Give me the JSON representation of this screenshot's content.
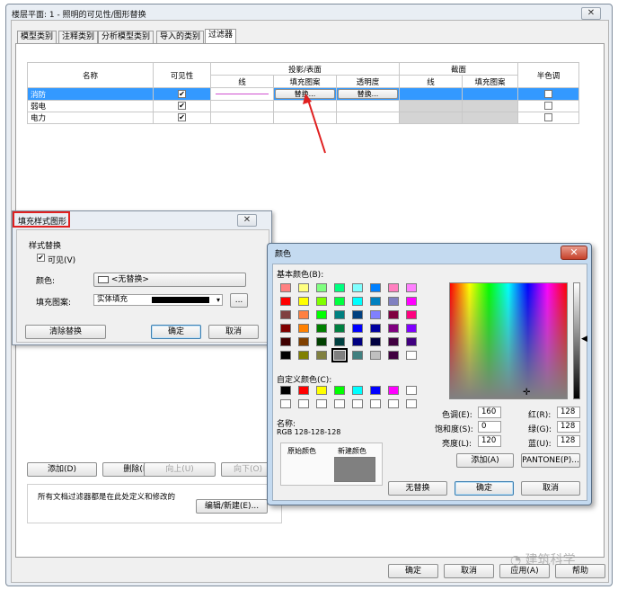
{
  "main_window": {
    "title": "楼层平面: 1 - 照明的可见性/图形替换",
    "close_icon": "close-icon",
    "tabs": [
      "模型类别",
      "注释类别",
      "分析模型类别",
      "导入的类别",
      "过滤器"
    ],
    "active_tab_index": 4,
    "table": {
      "headers": {
        "name": "名称",
        "visibility": "可见性",
        "projection_surface": "投影/表面",
        "cut": "截面",
        "halftone": "半色调",
        "line": "线",
        "fill_pattern": "填充图案",
        "transparency": "透明度",
        "cut_line": "线",
        "cut_fill_pattern": "填充图案"
      },
      "rows": [
        {
          "name": "消防",
          "visible": true,
          "proj_fill": "替换...",
          "transparency": "替换...",
          "halftone": false,
          "selected": true
        },
        {
          "name": "弱电",
          "visible": true,
          "proj_fill": "",
          "transparency": "",
          "halftone": false,
          "selected": false
        },
        {
          "name": "电力",
          "visible": true,
          "proj_fill": "",
          "transparency": "",
          "halftone": false,
          "selected": false
        }
      ]
    },
    "buttons": {
      "add": "添加(D)",
      "delete": "删除(R)",
      "up": "向上(U)",
      "down": "向下(O)",
      "edit_new": "编辑/新建(E)...",
      "ok": "确定",
      "cancel": "取消",
      "apply": "应用(A)",
      "help": "帮助"
    },
    "filters_note": "所有文档过滤器都是在此处定义和修改的"
  },
  "fill_dialog": {
    "title": "填充样式图形",
    "group_label": "样式替换",
    "visible_label": "可见(V)",
    "visible_checked": true,
    "color_label": "颜色:",
    "color_value": "<无替换>",
    "pattern_label": "填充图案:",
    "pattern_value": "实体填充",
    "browse": "...",
    "clear": "清除替换",
    "ok": "确定",
    "cancel": "取消"
  },
  "color_dialog": {
    "title": "颜色",
    "basic_colors_label": "基本颜色(B):",
    "custom_colors_label": "自定义颜色(C):",
    "name_label": "名称:",
    "name_value": "RGB 128-128-128",
    "original_label": "原始颜色",
    "new_label": "新建颜色",
    "hue_label": "色调(E):",
    "hue": "160",
    "sat_label": "饱和度(S):",
    "sat": "0",
    "lum_label": "亮度(L):",
    "lum": "120",
    "red_label": "红(R):",
    "red": "128",
    "green_label": "绿(G):",
    "green": "128",
    "blue_label": "蓝(U):",
    "blue": "128",
    "add_button": "添加(A)",
    "pantone_button": "PANTONE(P)...",
    "no_override": "无替换",
    "ok": "确定",
    "cancel": "取消",
    "basic_colors": [
      "#ff8080",
      "#ffff80",
      "#80ff80",
      "#00ff80",
      "#80ffff",
      "#0080ff",
      "#ff80c0",
      "#ff80ff",
      "#ff0000",
      "#ffff00",
      "#80ff00",
      "#00ff40",
      "#00ffff",
      "#0080c0",
      "#8080c0",
      "#ff00ff",
      "#804040",
      "#ff8040",
      "#00ff00",
      "#008080",
      "#004080",
      "#8080ff",
      "#800040",
      "#ff0080",
      "#800000",
      "#ff8000",
      "#008000",
      "#008040",
      "#0000ff",
      "#0000a0",
      "#800080",
      "#8000ff",
      "#400000",
      "#804000",
      "#004000",
      "#004040",
      "#000080",
      "#000040",
      "#400040",
      "#400080",
      "#000000",
      "#808000",
      "#808040",
      "#808080",
      "#408080",
      "#c0c0c0",
      "#400040",
      "#ffffff"
    ],
    "custom_colors": [
      "#000000",
      "#ff0000",
      "#ffff00",
      "#00ff00",
      "#00ffff",
      "#0000ff",
      "#ff00ff",
      "#ffffff",
      "#ffffff",
      "#ffffff",
      "#ffffff",
      "#ffffff",
      "#ffffff",
      "#ffffff",
      "#ffffff",
      "#ffffff"
    ],
    "new_color": "#808080"
  },
  "watermark": "建筑科学"
}
